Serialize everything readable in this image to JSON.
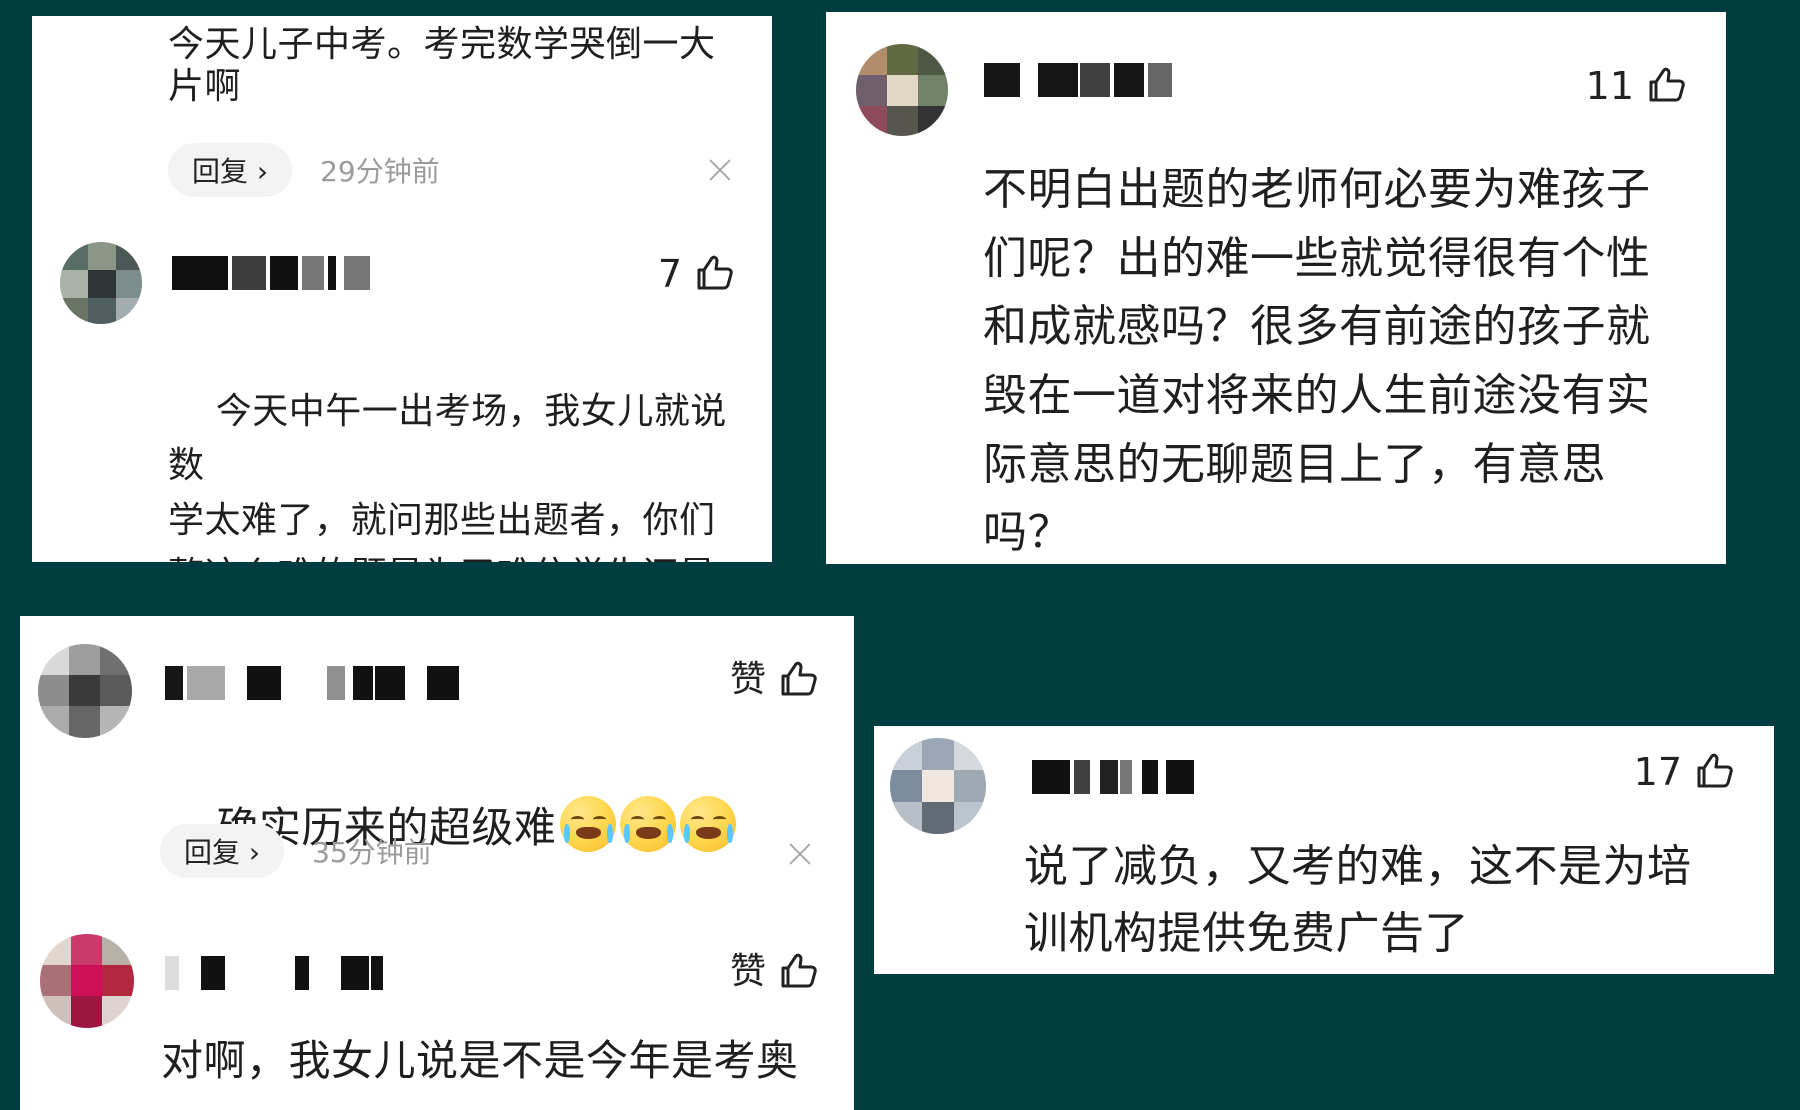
{
  "panel_1": {
    "top_comment": "今天儿子中考。考完数学哭倒一大\n片啊",
    "reply_label": "回复 ›",
    "timestamp": "29分钟前",
    "reply_comment": {
      "likes": "7",
      "text": "今天中午一出考场，我女儿就说数\n学太难了，就问那些出题者，你们\n整这么难的题是为了难住学生还是\n想说明你们的水平高"
    }
  },
  "panel_2": {
    "comment": {
      "likes": "11",
      "text": "不明白出题的老师何必要为难孩子\n们呢？出的难一些就觉得很有个性\n和成就感吗？很多有前途的孩子就\n毁在一道对将来的人生前途没有实\n际意思的无聊题目上了，有意思\n吗？"
    }
  },
  "panel_3": {
    "comment_1": {
      "likes": "赞",
      "text": "确实历来的超级难",
      "reply_label": "回复 ›",
      "timestamp": "35分钟前"
    },
    "comment_2": {
      "likes": "赞",
      "text": "对啊，我女儿说是不是今年是考奥"
    }
  },
  "panel_4": {
    "comment": {
      "likes": "17",
      "text": "说了减负，又考的难，这不是为培\n训机构提供免费广告了"
    }
  },
  "icons": {
    "thumb": "thumb-up-icon",
    "close": "close-icon",
    "smug": "smug-face-icon",
    "cry": "crying-face-icon"
  },
  "colors": {
    "background": "#003d40",
    "panel": "#ffffff",
    "text": "#1f1f1f",
    "muted": "#9b9b9b"
  }
}
